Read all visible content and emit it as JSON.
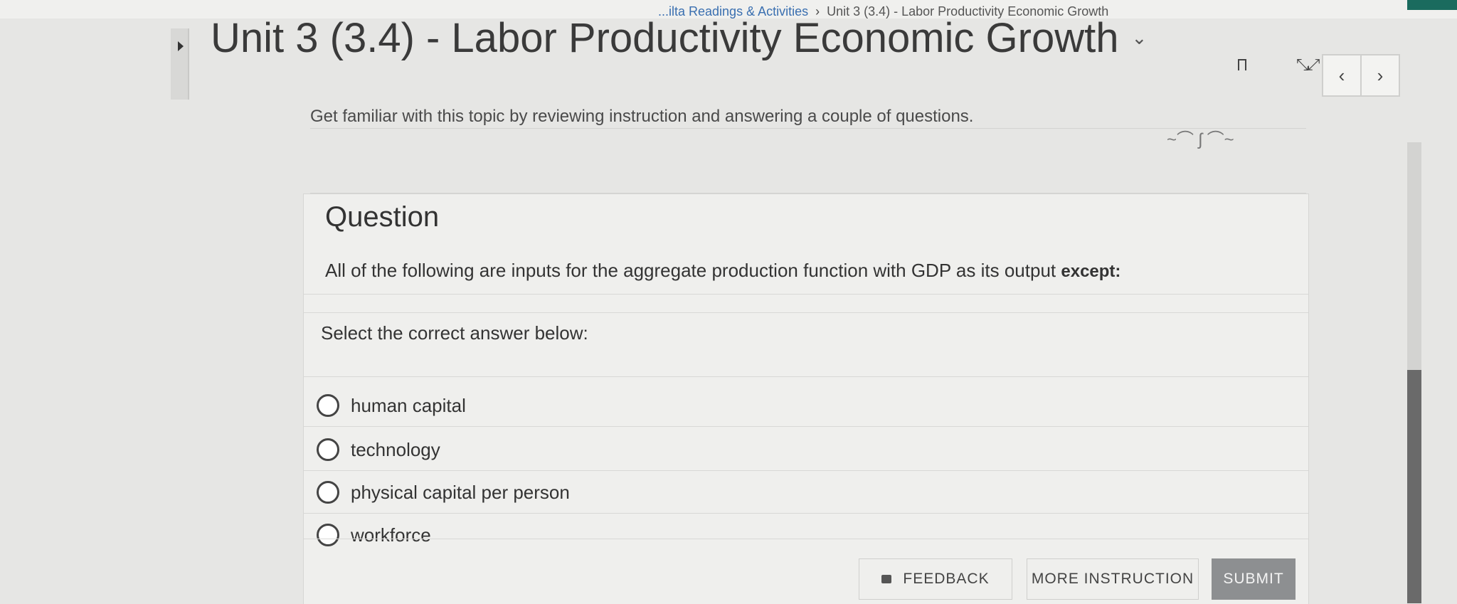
{
  "breadcrumb": {
    "items": [
      "...ilta Readings & Activities",
      "Unit 3 (3.4) - Labor Productivity Economic Growth"
    ],
    "separator": "›"
  },
  "header": {
    "title": "Unit 3 (3.4) - Labor Productivity Economic Growth",
    "chevron_icon": "chevron-down-icon",
    "bookmark_icon": "bookmark-icon",
    "expand_icon": "expand-icon",
    "prev_label": "‹",
    "next_label": "›"
  },
  "intro": {
    "text": "Get familiar with this topic by reviewing instruction and answering a couple of questions."
  },
  "question": {
    "heading": "Question",
    "prompt": "All of the following are inputs for the aggregate production function with GDP as its output",
    "prompt_emphasis": "except:",
    "select_label": "Select the correct answer below:",
    "options": [
      {
        "label": "human capital"
      },
      {
        "label": "technology"
      },
      {
        "label": "physical capital per person"
      },
      {
        "label": "workforce"
      }
    ]
  },
  "actions": {
    "feedback": "FEEDBACK",
    "more_instruction": "MORE INSTRUCTION",
    "submit": "SUBMIT"
  },
  "colors": {
    "submit_bg": "#8d8f91",
    "link": "#3a6fb0",
    "teal_accent": "#1a6b5e"
  }
}
